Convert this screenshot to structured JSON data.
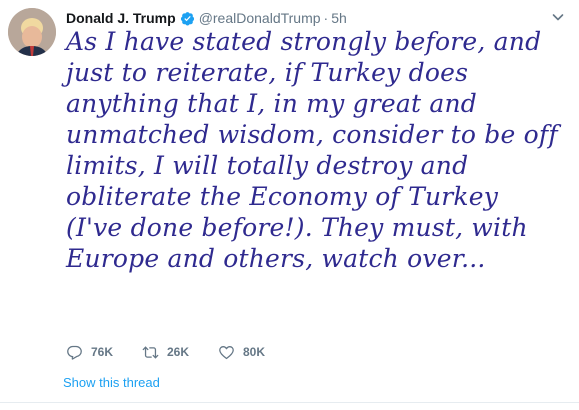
{
  "tweet": {
    "author_name": "Donald J. Trump",
    "handle": "@realDonaldTrump",
    "separator": "·",
    "time": "5h",
    "verified_icon": "verified-badge-icon",
    "lines": [
      "As I have stated strongly before, and",
      "just to reiterate, if Turkey does",
      "anything that I, in my great and",
      "unmatched wisdom, consider to be off",
      "limits, I will totally destroy and",
      "obliterate the Economy of Turkey",
      "(I've done before!). They must, with",
      "Europe and others, watch over..."
    ],
    "actions": {
      "replies": "76K",
      "retweets": "26K",
      "likes": "80K"
    },
    "show_thread": "Show this thread"
  },
  "colors": {
    "accent": "#1da1f2",
    "secondary_text": "#657786",
    "handwriting": "#2f2a8f"
  }
}
